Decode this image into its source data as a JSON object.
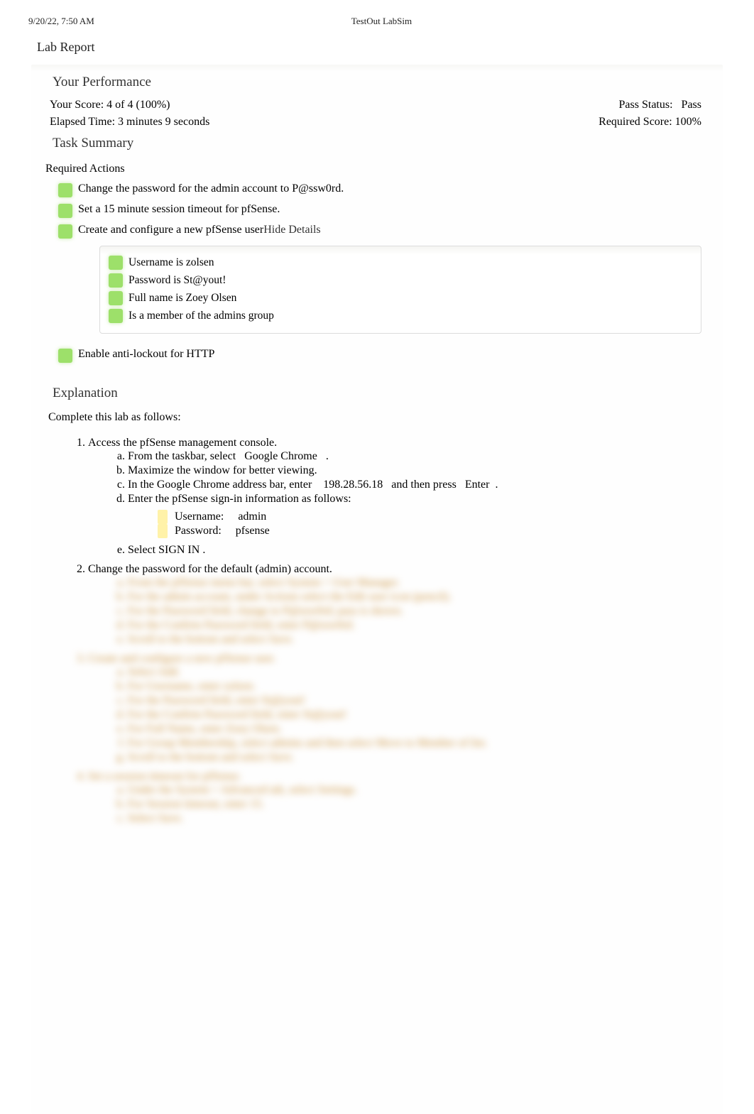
{
  "header": {
    "datetime": "9/20/22, 7:50 AM",
    "app": "TestOut LabSim"
  },
  "title": "Lab Report",
  "performance": {
    "heading": "Your Performance",
    "score_label": "Your Score: 4 of 4 (100%)",
    "pass_label": "Pass Status:",
    "pass_value": "Pass",
    "elapsed": "Elapsed Time: 3 minutes 9 seconds",
    "required": "Required Score: 100%"
  },
  "task_summary": {
    "heading": "Task Summary",
    "required_heading": "Required Actions",
    "actions": [
      "Change the password for the admin account to P@ssw0rd.",
      "Set a 15 minute session timeout for pfSense.",
      "Create and configure a new pfSense user",
      "Enable anti-lockout for HTTP"
    ],
    "toggle": "Hide Details",
    "details": [
      "Username is zolsen",
      "Password is St@yout!",
      "Full name is Zoey Olsen",
      "Is a member of the admins group"
    ]
  },
  "explanation": {
    "heading": "Explanation",
    "intro": "Complete this lab as follows:",
    "step1": {
      "title": "Access the pfSense management console.",
      "a_pre": "From the taskbar, select ",
      "a_kw": "Google Chrome",
      "a_post": ".",
      "b": "Maximize the window for better viewing.",
      "c_pre": "In the Google Chrome address bar, enter ",
      "c_ip": "198.28.56.18",
      "c_mid": " and then press ",
      "c_key": "Enter",
      "c_post": ".",
      "d": "Enter the pfSense sign-in information as follows:",
      "user_label": "Username:",
      "user_value": "admin",
      "pass_label": "Password:",
      "pass_value": "pfsense",
      "e_pre": "Select ",
      "e_kw": "SIGN IN",
      "e_post": "."
    },
    "step2": {
      "title": "Change the password for the default (admin) account.",
      "a": "From the pfSense menu bar, select System > User Manager.",
      "b": "For the admin account, under Actions select the Edit user icon (pencil).",
      "c": "For the Password field, change to P@ssw0rd; pass is shown.",
      "d": "For the Confirm Password field, enter P@ssw0rd.",
      "e": "Scroll to the bottom and select Save."
    },
    "step3": {
      "title": "Create and configure a new pfSense user.",
      "a": "Select Add.",
      "b": "For Username, enter zolsen.",
      "c": "For the Password field, enter St@yout!",
      "d": "For the Confirm Password field, enter St@yout!",
      "e": "For Full Name, enter Zoey Olsen.",
      "f": "For Group Membership, select admins and then select Move to Member of list.",
      "g": "Scroll to the bottom and select Save."
    },
    "step4": {
      "title": "Set a session timeout for pfSense.",
      "a": "Under the System > Advanced tab, select Settings.",
      "b": "For Session timeout, enter 15.",
      "c": "Select Save."
    }
  }
}
